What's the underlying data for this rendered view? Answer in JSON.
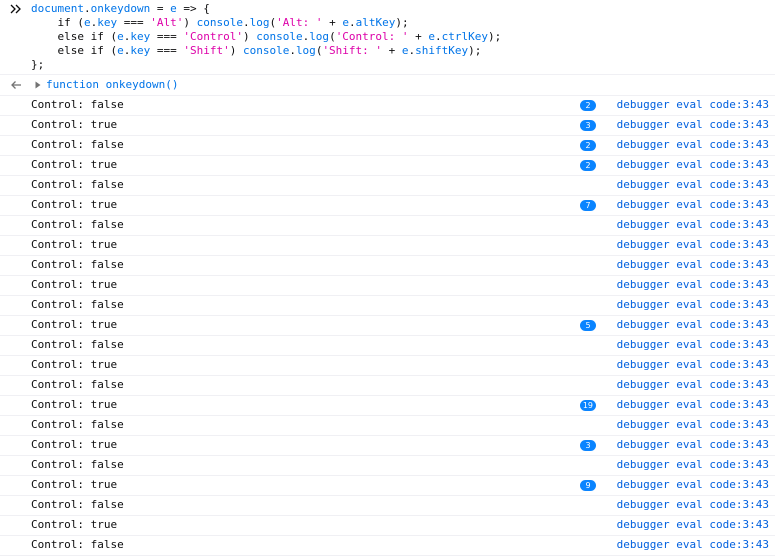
{
  "input": {
    "line1": {
      "a": "document",
      "b": ".",
      "c": "onkeydown",
      "d": " = ",
      "e": "e",
      "f": " => {"
    },
    "line2": {
      "a": "    if (",
      "b": "e",
      "c": ".",
      "d": "key",
      "e": " === ",
      "f": "'Alt'",
      "g": ") ",
      "h": "console",
      "i": ".",
      "j": "log",
      "k": "(",
      "l": "'Alt: '",
      "m": " + ",
      "n": "e",
      "o": ".",
      "p": "altKey",
      "q": ");"
    },
    "line3": {
      "a": "    else if (",
      "b": "e",
      "c": ".",
      "d": "key",
      "e": " === ",
      "f": "'Control'",
      "g": ") ",
      "h": "console",
      "i": ".",
      "j": "log",
      "k": "(",
      "l": "'Control: '",
      "m": " + ",
      "n": "e",
      "o": ".",
      "p": "ctrlKey",
      "q": ");"
    },
    "line4": {
      "a": "    else if (",
      "b": "e",
      "c": ".",
      "d": "key",
      "e": " === ",
      "f": "'Shift'",
      "g": ") ",
      "h": "console",
      "i": ".",
      "j": "log",
      "k": "(",
      "l": "'Shift: '",
      "m": " + ",
      "n": "e",
      "o": ".",
      "p": "shiftKey",
      "q": ");"
    },
    "line5": "};"
  },
  "result": {
    "text": "function onkeydown()"
  },
  "icons": {
    "prompt": "chevrons-right-icon",
    "result": "arrow-left-icon",
    "twisty": "triangle-right-icon"
  },
  "colors": {
    "badge": "#0a84ff",
    "link": "#0060df",
    "keyword_var": "#0074e8",
    "string": "#dd00a9"
  },
  "logs": [
    {
      "text": "Control: false",
      "count": "2",
      "location": "debugger eval code:3:43"
    },
    {
      "text": "Control: true",
      "count": "3",
      "location": "debugger eval code:3:43"
    },
    {
      "text": "Control: false",
      "count": "2",
      "location": "debugger eval code:3:43"
    },
    {
      "text": "Control: true",
      "count": "2",
      "location": "debugger eval code:3:43"
    },
    {
      "text": "Control: false",
      "count": "",
      "location": "debugger eval code:3:43"
    },
    {
      "text": "Control: true",
      "count": "7",
      "location": "debugger eval code:3:43"
    },
    {
      "text": "Control: false",
      "count": "",
      "location": "debugger eval code:3:43"
    },
    {
      "text": "Control: true",
      "count": "",
      "location": "debugger eval code:3:43"
    },
    {
      "text": "Control: false",
      "count": "",
      "location": "debugger eval code:3:43"
    },
    {
      "text": "Control: true",
      "count": "",
      "location": "debugger eval code:3:43"
    },
    {
      "text": "Control: false",
      "count": "",
      "location": "debugger eval code:3:43"
    },
    {
      "text": "Control: true",
      "count": "5",
      "location": "debugger eval code:3:43"
    },
    {
      "text": "Control: false",
      "count": "",
      "location": "debugger eval code:3:43"
    },
    {
      "text": "Control: true",
      "count": "",
      "location": "debugger eval code:3:43"
    },
    {
      "text": "Control: false",
      "count": "",
      "location": "debugger eval code:3:43"
    },
    {
      "text": "Control: true",
      "count": "19",
      "location": "debugger eval code:3:43"
    },
    {
      "text": "Control: false",
      "count": "",
      "location": "debugger eval code:3:43"
    },
    {
      "text": "Control: true",
      "count": "3",
      "location": "debugger eval code:3:43"
    },
    {
      "text": "Control: false",
      "count": "",
      "location": "debugger eval code:3:43"
    },
    {
      "text": "Control: true",
      "count": "9",
      "location": "debugger eval code:3:43"
    },
    {
      "text": "Control: false",
      "count": "",
      "location": "debugger eval code:3:43"
    },
    {
      "text": "Control: true",
      "count": "",
      "location": "debugger eval code:3:43"
    },
    {
      "text": "Control: false",
      "count": "",
      "location": "debugger eval code:3:43"
    }
  ]
}
